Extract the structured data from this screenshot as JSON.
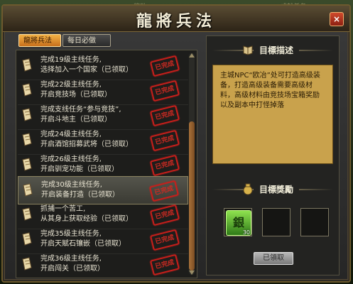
{
  "window": {
    "title": "龍將兵法",
    "close_glyph": "×"
  },
  "background_fragments": [
    "奖励",
    "成就任务"
  ],
  "tabs": [
    {
      "label": "龍將兵法",
      "active": true
    },
    {
      "label": "每日必做",
      "active": false
    }
  ],
  "quests": [
    {
      "line1": "完成19级主线任务,",
      "line2": "选择加入一个国家（已领取）",
      "stamp": "已完成",
      "selected": false
    },
    {
      "line1": "完成22级主线任务,",
      "line2": "开启竞技场（已领取）",
      "stamp": "已完成",
      "selected": false
    },
    {
      "line1": "完成支线任务“参与竞技”,",
      "line2": "开启斗地主（已领取）",
      "stamp": "已完成",
      "selected": false
    },
    {
      "line1": "完成24级主线任务,",
      "line2": "开启酒馆招募武将（已领取）",
      "stamp": "已完成",
      "selected": false
    },
    {
      "line1": "完成26级主线任务,",
      "line2": "开启驯宠功能（已领取）",
      "stamp": "已完成",
      "selected": false
    },
    {
      "line1": "完成30级主线任务,",
      "line2": "开启装备打造（已领取）",
      "stamp": "已完成",
      "selected": true
    },
    {
      "line1": "抓捕一个苦工,",
      "line2": "从其身上获取经验（已领取）",
      "stamp": "已完成",
      "selected": false
    },
    {
      "line1": "完成35级主线任务,",
      "line2": "开启天赋石镶嵌（已领取）",
      "stamp": "已完成",
      "selected": false
    },
    {
      "line1": "完成36级主线任务,",
      "line2": "开启闯关（已领取）",
      "stamp": "已完成",
      "selected": false
    }
  ],
  "goal": {
    "header": "目標描述",
    "text": "主城NPC“欧冶”处可打造高级装备，打造高级装备需要高级材料，高级材料由竞技场宝箱奖励以及副本中打怪掉落"
  },
  "reward": {
    "header": "目標獎勵",
    "items": [
      {
        "glyph": "銀",
        "qty": "30",
        "icon": "silver-coin-icon"
      },
      {
        "glyph": "",
        "qty": ""
      },
      {
        "glyph": "",
        "qty": ""
      }
    ],
    "button_label": "已領取"
  },
  "colors": {
    "stamp_red": "#c71f1b",
    "tab_active": "#e2942f",
    "desc_bg": "#c9a24c",
    "item_green": "#5fbf32"
  }
}
